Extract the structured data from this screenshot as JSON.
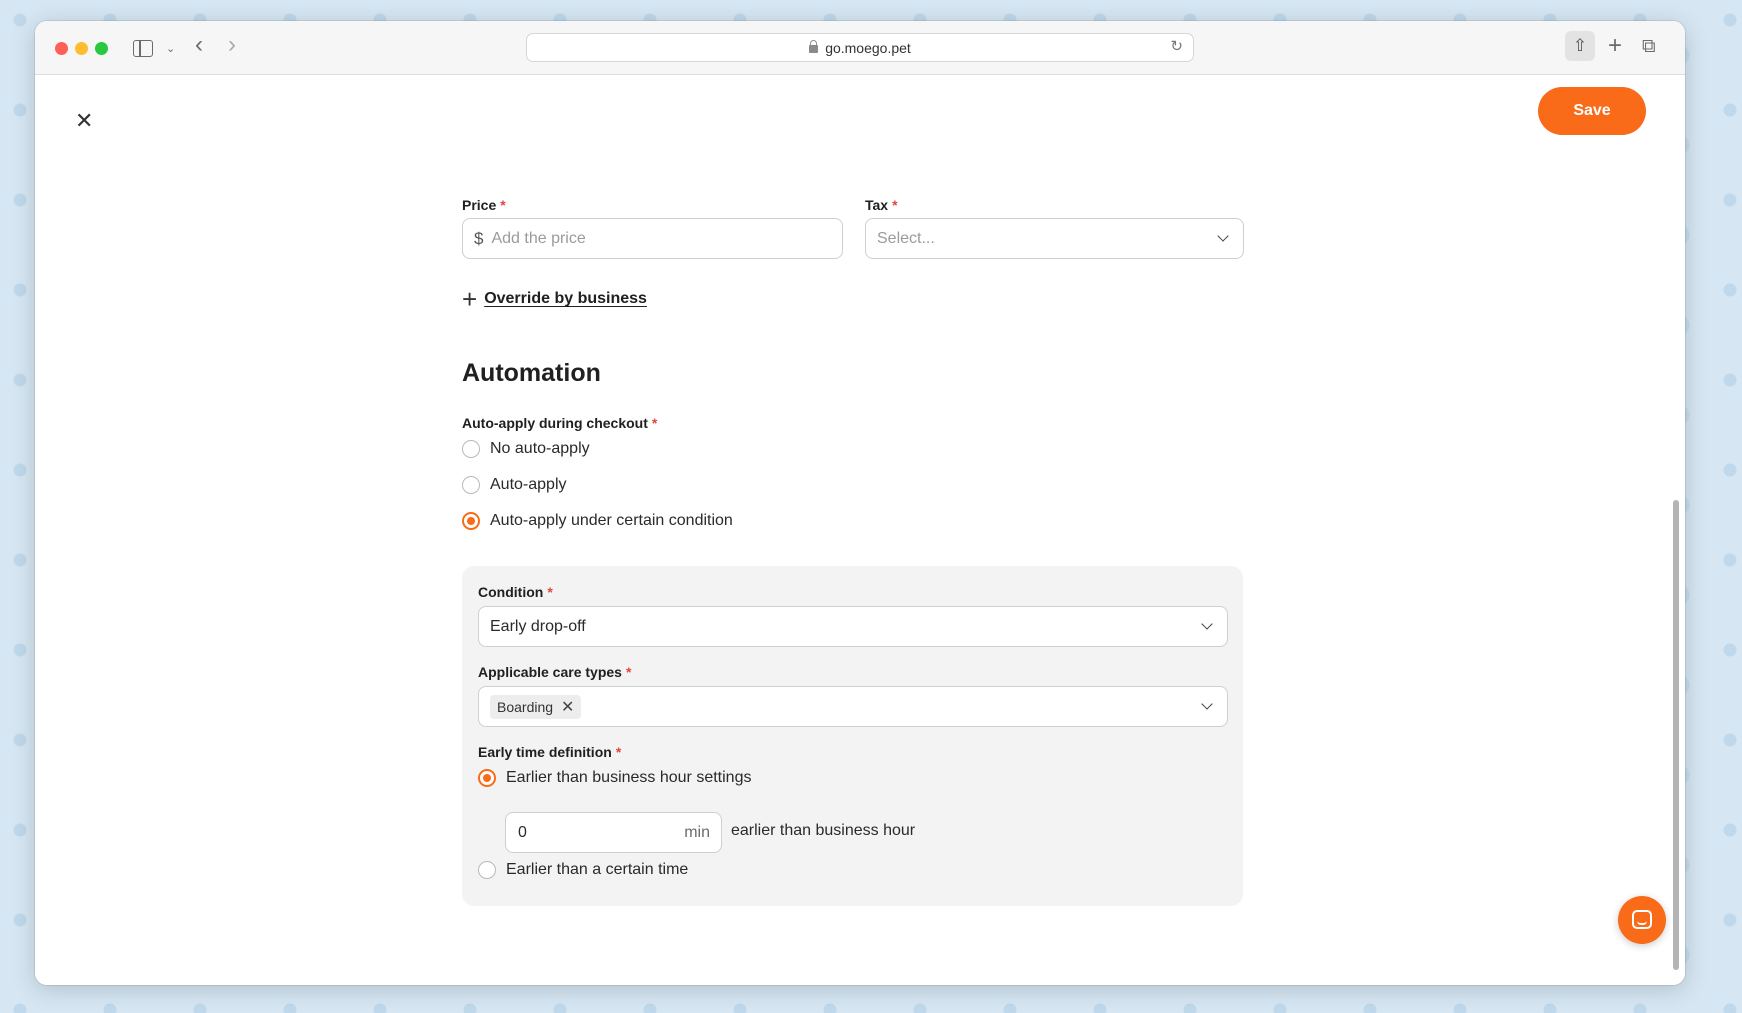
{
  "browser": {
    "url": "go.moego.pet"
  },
  "toolbar": {
    "save_label": "Save"
  },
  "form": {
    "price": {
      "label": "Price",
      "required_mark": "*",
      "currency_symbol": "$",
      "placeholder": "Add the price"
    },
    "tax": {
      "label": "Tax",
      "required_mark": "*",
      "placeholder": "Select..."
    },
    "override_label": "Override by business"
  },
  "automation": {
    "title": "Automation",
    "auto_apply": {
      "label": "Auto-apply during checkout",
      "required_mark": "*",
      "options": [
        {
          "label": "No auto-apply",
          "selected": false
        },
        {
          "label": "Auto-apply",
          "selected": false
        },
        {
          "label": "Auto-apply under certain condition",
          "selected": true
        }
      ]
    },
    "condition": {
      "label": "Condition",
      "required_mark": "*",
      "value": "Early drop-off"
    },
    "care_types": {
      "label": "Applicable care types",
      "required_mark": "*",
      "chips": [
        "Boarding"
      ]
    },
    "early_time": {
      "label": "Early time definition",
      "required_mark": "*",
      "options": [
        {
          "label": "Earlier than business hour settings",
          "selected": true
        },
        {
          "label": "Earlier than a certain time",
          "selected": false
        }
      ],
      "minutes_value": "0",
      "minutes_unit": "min",
      "suffix_text": "earlier than business hour"
    }
  },
  "colors": {
    "accent": "#f96b18",
    "required": "#e0473e",
    "panel_bg": "#f3f3f3"
  },
  "icons": {
    "close": "close-icon",
    "chevron": "chevron-down-icon",
    "plus": "plus-icon",
    "chat": "chat-icon"
  }
}
